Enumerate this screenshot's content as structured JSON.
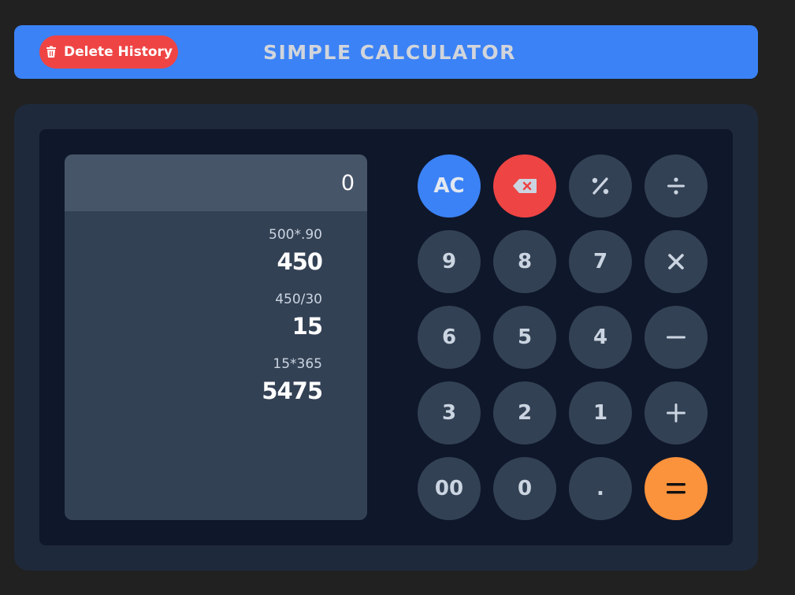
{
  "header": {
    "delete_label": "Delete History",
    "title": "SIMPLE CALCULATOR"
  },
  "display": {
    "current": "0",
    "history": [
      {
        "expression": "500*.90",
        "result": "450"
      },
      {
        "expression": "450/30",
        "result": "15"
      },
      {
        "expression": "15*365",
        "result": "5475"
      }
    ]
  },
  "keys": {
    "ac": "AC",
    "nine": "9",
    "eight": "8",
    "seven": "7",
    "six": "6",
    "five": "5",
    "four": "4",
    "three": "3",
    "two": "2",
    "one": "1",
    "double_zero": "00",
    "zero": "0",
    "dot": "."
  },
  "icons": {
    "delete": "trash-icon",
    "backspace": "backspace-icon",
    "percent": "percent-icon",
    "divide": "divide-icon",
    "multiply": "multiply-icon",
    "minus": "minus-icon",
    "plus": "plus-icon",
    "equals": "equals-icon"
  },
  "colors": {
    "accent": "#3b82f6",
    "danger": "#ef4444",
    "equals": "#fb923c",
    "key": "#334155"
  }
}
